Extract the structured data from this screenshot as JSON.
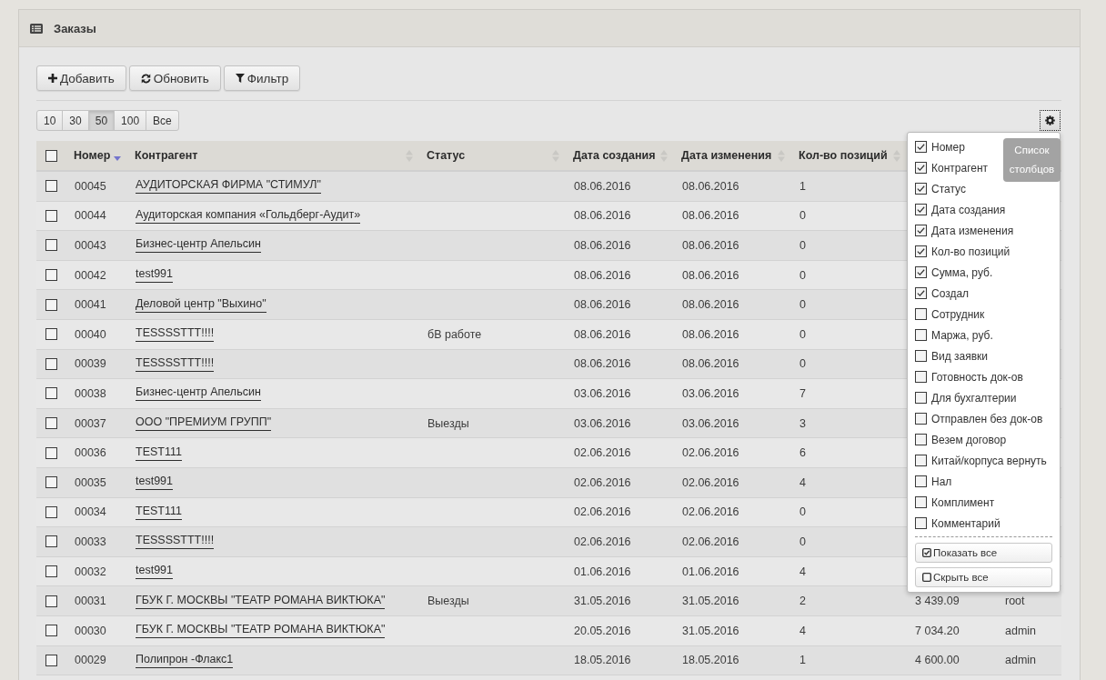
{
  "panel": {
    "title": "Заказы"
  },
  "toolbar": [
    {
      "label": "Добавить",
      "kind": "add"
    },
    {
      "label": "Обновить",
      "kind": "refresh"
    },
    {
      "label": "Фильтр",
      "kind": "filter"
    }
  ],
  "page_sizes": [
    {
      "label": "10",
      "selected": false
    },
    {
      "label": "30",
      "selected": false
    },
    {
      "label": "50",
      "selected": true
    },
    {
      "label": "100",
      "selected": false
    },
    {
      "label": "Все",
      "selected": false
    }
  ],
  "settings_button": {
    "tooltip": "Список столбцов"
  },
  "table": {
    "select_all": {
      "checked": false
    },
    "columns": [
      {
        "label": "Номер",
        "sorted": true
      },
      {
        "label": "Контрагент",
        "sorted": false
      },
      {
        "label": "Статус",
        "sorted": false
      },
      {
        "label": "Дата создания",
        "sorted": false
      },
      {
        "label": "Дата изменения",
        "sorted": false
      },
      {
        "label": "Кол-во позиций",
        "sorted": false
      }
    ],
    "rows": [
      {
        "checked": false,
        "number": "00045",
        "counterparty": "АУДИТОРСКАЯ ФИРМА \"СТИМУЛ\"",
        "created": "08.06.2016",
        "modified": "08.06.2016",
        "positions": "1"
      },
      {
        "checked": false,
        "number": "00044",
        "counterparty": "Аудиторская компания «Гольдберг-Аудит»",
        "created": "08.06.2016",
        "modified": "08.06.2016",
        "positions": "0"
      },
      {
        "checked": false,
        "number": "00043",
        "counterparty": "Бизнес-центр Апельсин",
        "created": "08.06.2016",
        "modified": "08.06.2016",
        "positions": "0"
      },
      {
        "checked": false,
        "number": "00042",
        "counterparty": "test991",
        "created": "08.06.2016",
        "modified": "08.06.2016",
        "positions": "0"
      },
      {
        "checked": false,
        "number": "00041",
        "counterparty": "Деловой центр \"Выхино\"",
        "created": "08.06.2016",
        "modified": "08.06.2016",
        "positions": "0"
      },
      {
        "checked": false,
        "number": "00040",
        "counterparty": "TESSSSTTT!!!!",
        "status": "бВ работе",
        "created": "08.06.2016",
        "modified": "08.06.2016",
        "positions": "0"
      },
      {
        "checked": false,
        "number": "00039",
        "counterparty": "TESSSSTTT!!!!",
        "created": "08.06.2016",
        "modified": "08.06.2016",
        "positions": "0"
      },
      {
        "checked": false,
        "number": "00038",
        "counterparty": "Бизнес-центр Апельсин",
        "created": "03.06.2016",
        "modified": "03.06.2016",
        "positions": "7"
      },
      {
        "checked": false,
        "number": "00037",
        "counterparty": "ООО \"ПРЕМИУМ ГРУПП\"",
        "status": "Выезды",
        "created": "03.06.2016",
        "modified": "03.06.2016",
        "positions": "3"
      },
      {
        "checked": false,
        "number": "00036",
        "counterparty": "TEST111",
        "created": "02.06.2016",
        "modified": "02.06.2016",
        "positions": "6"
      },
      {
        "checked": false,
        "number": "00035",
        "counterparty": "test991",
        "created": "02.06.2016",
        "modified": "02.06.2016",
        "positions": "4"
      },
      {
        "checked": false,
        "number": "00034",
        "counterparty": "TEST111",
        "created": "02.06.2016",
        "modified": "02.06.2016",
        "positions": "0"
      },
      {
        "checked": false,
        "number": "00033",
        "counterparty": "TESSSSTTT!!!!",
        "created": "02.06.2016",
        "modified": "02.06.2016",
        "positions": "0"
      },
      {
        "checked": false,
        "number": "00032",
        "counterparty": "test991",
        "created": "01.06.2016",
        "modified": "01.06.2016",
        "positions": "4"
      },
      {
        "checked": false,
        "number": "00031",
        "counterparty": "ГБУК Г. МОСКВЫ \"ТЕАТР РОМАНА ВИКТЮКА\"",
        "status": "Выезды",
        "created": "31.05.2016",
        "modified": "31.05.2016",
        "positions": "2",
        "sum": "3 439.09",
        "creator": "root"
      },
      {
        "checked": false,
        "number": "00030",
        "counterparty": "ГБУК Г. МОСКВЫ \"ТЕАТР РОМАНА ВИКТЮКА\"",
        "created": "20.05.2016",
        "modified": "31.05.2016",
        "positions": "4",
        "sum": "7 034.20",
        "creator": "admin"
      },
      {
        "checked": false,
        "number": "00029",
        "counterparty": "Полипрон -Флакс1",
        "created": "18.05.2016",
        "modified": "18.05.2016",
        "positions": "1",
        "sum": "4 600.00",
        "creator": "admin"
      }
    ]
  },
  "column_menu": {
    "items": [
      {
        "label": "Номер",
        "checked": true
      },
      {
        "label": "Контрагент",
        "checked": true
      },
      {
        "label": "Статус",
        "checked": true
      },
      {
        "label": "Дата создания",
        "checked": true
      },
      {
        "label": "Дата изменения",
        "checked": true
      },
      {
        "label": "Кол-во позиций",
        "checked": true
      },
      {
        "label": "Сумма, руб.",
        "checked": true
      },
      {
        "label": "Создал",
        "checked": true
      },
      {
        "label": "Сотрудник",
        "checked": false
      },
      {
        "label": "Маржа, руб.",
        "checked": false
      },
      {
        "label": "Вид заявки",
        "checked": false
      },
      {
        "label": "Готовность док-ов",
        "checked": false
      },
      {
        "label": "Для бухгалтерии",
        "checked": false
      },
      {
        "label": "Отправлен без док-ов",
        "checked": false
      },
      {
        "label": "Везем договор",
        "checked": false
      },
      {
        "label": "Китай/корпуса вернуть",
        "checked": false
      },
      {
        "label": "Нал",
        "checked": false
      },
      {
        "label": "Комплимент",
        "checked": false
      },
      {
        "label": "Комментарий",
        "checked": false
      }
    ],
    "buttons": [
      {
        "label": "Показать все",
        "kind": "show_all"
      },
      {
        "label": "Скрыть все",
        "kind": "hide_all"
      }
    ]
  }
}
